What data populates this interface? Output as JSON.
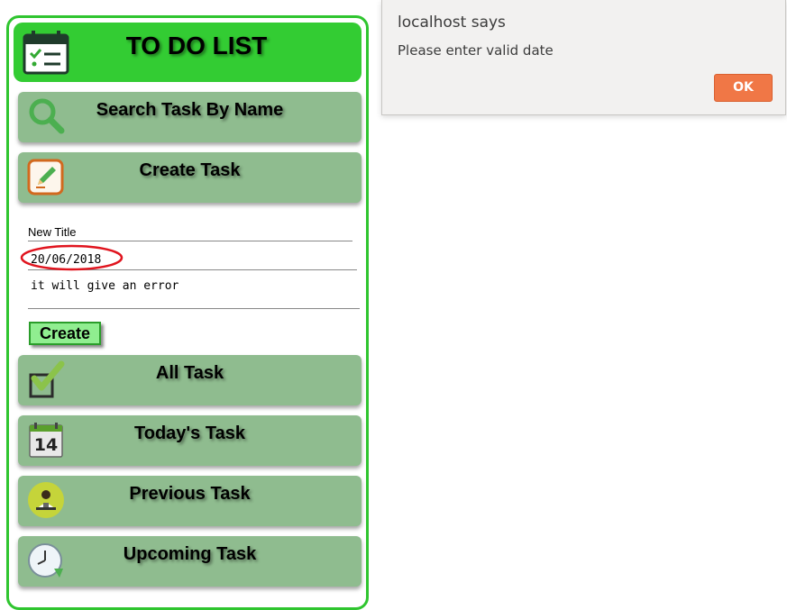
{
  "app": {
    "title": "TO DO LIST",
    "colors": {
      "header": "#33cc33",
      "border": "#2fc52f",
      "menu": "#8fbc8f",
      "create": "#90ee90"
    }
  },
  "menu": {
    "search": {
      "label": "Search Task By Name",
      "icon": "magnifier-icon"
    },
    "create": {
      "label": "Create Task",
      "icon": "pencil-icon"
    },
    "all": {
      "label": "All Task",
      "icon": "checkbox-icon"
    },
    "today": {
      "label": "Today's Task",
      "icon": "calendar-14-icon"
    },
    "previous": {
      "label": "Previous Task",
      "icon": "person-at-desk-icon"
    },
    "upcoming": {
      "label": "Upcoming Task",
      "icon": "clock-icon"
    }
  },
  "form": {
    "title_value": "New Title",
    "date_value": "20/06/2018",
    "description_value": "it will give an error",
    "create_label": "Create"
  },
  "dialog": {
    "title": "localhost says",
    "message": "Please enter valid date",
    "ok_label": "OK",
    "ok_color": "#f07746"
  }
}
